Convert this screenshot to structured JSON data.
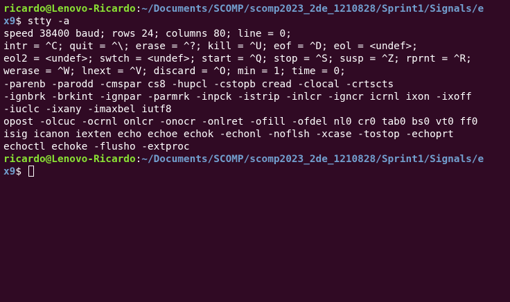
{
  "terminal": {
    "prompt1": {
      "user": "ricardo@Lenovo-Ricardo",
      "sep": ":",
      "path": "~/Documents/SCOMP/scomp2023_2de_1210828/Sprint1/Signals/e",
      "path_wrap": "x9",
      "symbol": "$ ",
      "command": "stty -a"
    },
    "output": [
      "speed 38400 baud; rows 24; columns 80; line = 0;",
      "intr = ^C; quit = ^\\; erase = ^?; kill = ^U; eof = ^D; eol = <undef>;",
      "eol2 = <undef>; swtch = <undef>; start = ^Q; stop = ^S; susp = ^Z; rprnt = ^R;",
      "werase = ^W; lnext = ^V; discard = ^O; min = 1; time = 0;",
      "-parenb -parodd -cmspar cs8 -hupcl -cstopb cread -clocal -crtscts",
      "-ignbrk -brkint -ignpar -parmrk -inpck -istrip -inlcr -igncr icrnl ixon -ixoff",
      "-iuclc -ixany -imaxbel iutf8",
      "opost -olcuc -ocrnl onlcr -onocr -onlret -ofill -ofdel nl0 cr0 tab0 bs0 vt0 ff0",
      "isig icanon iexten echo echoe echok -echonl -noflsh -xcase -tostop -echoprt",
      "echoctl echoke -flusho -extproc"
    ],
    "prompt2": {
      "user": "ricardo@Lenovo-Ricardo",
      "sep": ":",
      "path": "~/Documents/SCOMP/scomp2023_2de_1210828/Sprint1/Signals/e",
      "path_wrap": "x9",
      "symbol": "$ "
    },
    "colors": {
      "background": "#300a24",
      "user": "#8ae234",
      "path": "#729fcf",
      "text": "#ffffff"
    }
  }
}
